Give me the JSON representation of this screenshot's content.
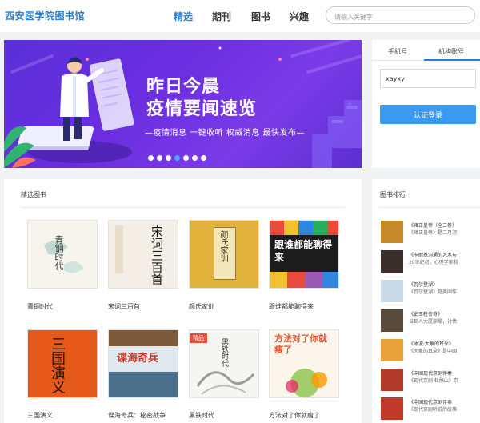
{
  "header": {
    "logo": "西安医学院图书馆",
    "nav": [
      "精选",
      "期刊",
      "图书",
      "兴趣"
    ],
    "search_placeholder": "请输入关键字"
  },
  "banner": {
    "title_line1": "昨日今晨",
    "title_line2": "疫情要闻速览",
    "subtitle": "—疫情消息 一键收听 权威消息 最快发布—",
    "dot_count": 7,
    "active_dot": 3
  },
  "login": {
    "tabs": [
      "手机号",
      "机构账号"
    ],
    "active_tab": 1,
    "account_value": "xayxy",
    "submit_label": "认证登录"
  },
  "featured": {
    "title": "精选图书",
    "books": [
      {
        "title": "青铜时代",
        "cover_text": "青铜时代"
      },
      {
        "title": "宋词三百首",
        "cover_text": "宋词三百首"
      },
      {
        "title": "颜氏家训",
        "cover_text": "颜氏家训"
      },
      {
        "title": "跟谁都能聊得来",
        "cover_text": "跟谁都能聊得来"
      },
      {
        "title": "三国演义",
        "cover_text": "三国演义"
      },
      {
        "title": "谍海奇兵：秘密战争",
        "cover_text": "谍海奇兵"
      },
      {
        "title": "黑铁时代",
        "cover_text": "黑铁时代",
        "badge": "精品"
      },
      {
        "title": "方法对了你就瘦了",
        "cover_text": "方法对了你就瘦了"
      }
    ]
  },
  "ranking": {
    "title": "图书排行",
    "items": [
      {
        "line1": "《雍正皇帝（全三卷）",
        "line2": "《雍正皇帝》是二月河"
      },
      {
        "line1": "《卡耐基沟通的艺术与",
        "line2": "20世纪初，心理学家和"
      },
      {
        "line1": "《瓦尔登湖》",
        "line2": "《瓦尔登湖》是美国作"
      },
      {
        "line1": "《史玉柱传奇》",
        "line2": "当巨人大厦崩塌，讨债"
      },
      {
        "line1": "《冰波·大象的耳朵》",
        "line2": "《大象的耳朵》是中国"
      },
      {
        "line1": "《中国现代京剧伴奏",
        "line2": "《现代京剧 杜鹃山》京"
      },
      {
        "line1": "《中国现代京剧伴奏",
        "line2": "《现代京剧听说的故事"
      }
    ]
  }
}
